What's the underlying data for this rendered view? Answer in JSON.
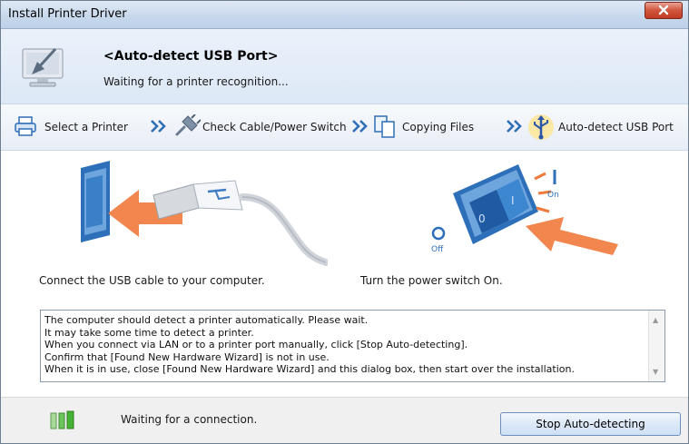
{
  "window": {
    "title": "Install Printer Driver"
  },
  "header": {
    "title": "<Auto-detect USB Port>",
    "subtitle": "Waiting for a printer recognition..."
  },
  "steps": [
    {
      "label": "Select a Printer",
      "icon": "printer-icon"
    },
    {
      "label": "Check Cable/Power Switch",
      "icon": "plug-icon"
    },
    {
      "label": "Copying Files",
      "icon": "copy-files-icon"
    },
    {
      "label": "Auto-detect USB Port",
      "icon": "usb-icon",
      "active": true
    }
  ],
  "illustrations": {
    "cable_caption": "Connect the USB cable to your computer.",
    "switch_caption": "Turn the power switch On.",
    "switch_on_label": "On",
    "switch_off_label": "Off"
  },
  "info_lines": [
    "The computer should detect a printer automatically. Please wait.",
    "It may take some time to detect a printer.",
    "When you connect via LAN or to a printer port manually, click [Stop Auto-detecting].",
    "Confirm that [Found New Hardware Wizard] is not in use.",
    "When it is in use, close [Found New Hardware Wizard] and this dialog box, then start over the installation."
  ],
  "footer": {
    "status": "Waiting for a connection.",
    "stop_button": "Stop Auto-detecting"
  },
  "colors": {
    "arrow": "#f07a3c",
    "accent_blue": "#2f6fb6",
    "connection_green": "#44b233",
    "close_red": "#c94a32"
  }
}
